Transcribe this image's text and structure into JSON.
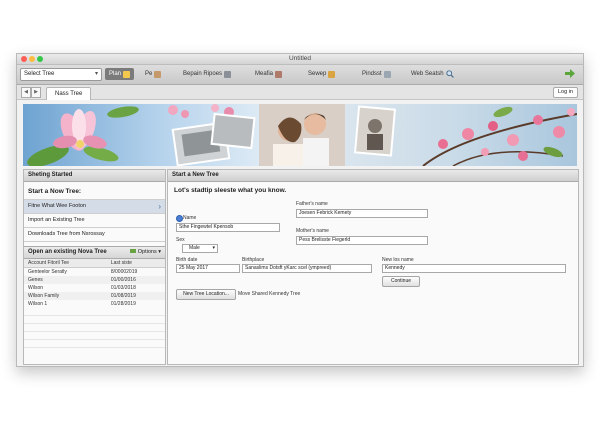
{
  "window": {
    "title": "Untitled",
    "traffic_light_colors": [
      "#fc5d55",
      "#fdbc3f",
      "#34c748"
    ]
  },
  "toolbar": {
    "tree_select": {
      "value": "Select Tree"
    },
    "buttons": [
      {
        "label": "Plan",
        "icon": "clipboard-icon",
        "active": true
      },
      {
        "label": "Pe",
        "icon": "person-icon"
      },
      {
        "label": "Bepain Ripoes",
        "icon": "book-icon"
      },
      {
        "label": "Meafia",
        "icon": "media-icon"
      },
      {
        "label": "Sewep",
        "icon": "photo-icon"
      },
      {
        "label": "Pindsst",
        "icon": "document-icon"
      },
      {
        "label": "Web Seatsh",
        "icon": "search-icon"
      }
    ],
    "right_icon": "green-arrow-icon"
  },
  "tabs": {
    "active_tab": "Nass Tree",
    "login_label": "Log in"
  },
  "sidebar": {
    "header": "Sheting Started",
    "subtitle": "Start a Now Tree:",
    "options": [
      {
        "label": "Fitne What Wee Footon",
        "selected": true
      },
      {
        "label": "Import an Existing Tree"
      },
      {
        "label": "Downloads Tree from Nsrossay"
      }
    ],
    "existing": {
      "title": "Open an existing Nova Tree",
      "options_label": "Options",
      "columns": [
        "Account Fitoril Tee",
        "Last siste"
      ],
      "rows": [
        [
          "Genteelor Seratly",
          "8/00002019"
        ],
        [
          "Genes",
          "01/00/2016"
        ],
        [
          "Wilson",
          "01/03/2018"
        ],
        [
          "Wilson Family",
          "01/08/2019"
        ],
        [
          "Wilson 1",
          "01/28/2019"
        ]
      ]
    }
  },
  "main": {
    "header": "Start a New Tree",
    "intro": "Lot's stadtip sleeste what you know.",
    "name_label": "Name",
    "name_value": "Sthe Fingewtel Kpensob",
    "sex_label": "Sex",
    "sex_value": "Male",
    "birth_label": "Birth date",
    "birth_value": "25 May 2017",
    "birthplace_label": "Birthplace",
    "birthplace_value": "Sanaslims Dotsft yKarc scel (ympreed)",
    "father_label": "Father's name",
    "father_value": "Joesen Febrick Kemety",
    "mother_label": "Mother's name",
    "mother_value": "Pess Brelisste Fiegerld",
    "lastname_label": "New los name",
    "lastname_value": "Kennedy",
    "continue_label": "Continue",
    "location_button": "New Tree Location...",
    "move_label": "Move Shared Kennedy Tree"
  }
}
